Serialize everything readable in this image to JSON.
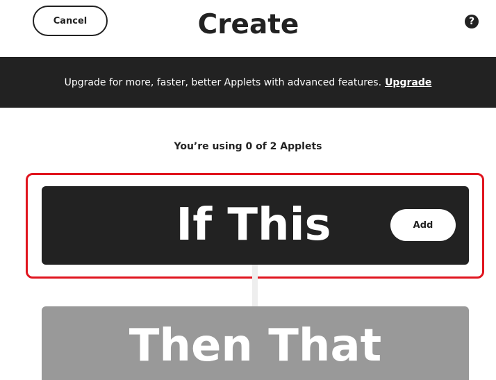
{
  "header": {
    "cancel_label": "Cancel",
    "title": "Create",
    "help_glyph": "?",
    "help_icon": "question-circle-icon"
  },
  "banner": {
    "message": "Upgrade for more, faster, better Applets with advanced features.",
    "link_label": "Upgrade"
  },
  "usage": {
    "text": "You’re using 0 of 2 Applets"
  },
  "trigger": {
    "label": "If This",
    "add_label": "Add",
    "highlighted": true
  },
  "action": {
    "label": "Then That"
  },
  "colors": {
    "dark": "#222222",
    "disabled": "#999999",
    "highlight": "#e0141e",
    "background": "#ffffff"
  }
}
